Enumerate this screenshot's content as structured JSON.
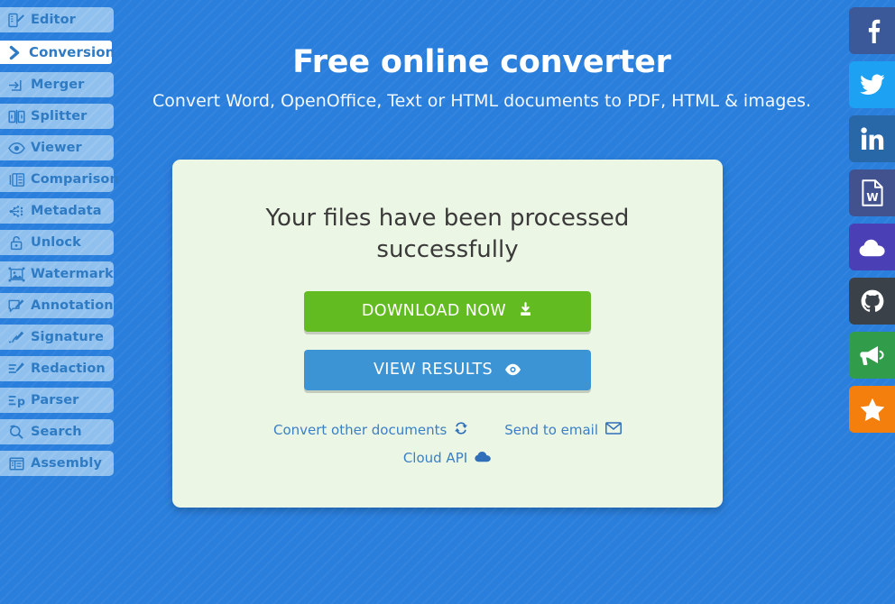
{
  "colors": {
    "page_bg": "#2a7fdd",
    "sidebar_item_bg": "#8fc0ee",
    "sidebar_item_text": "#2e7bc4",
    "card_bg": "#ecf6e4",
    "download_green": "#62bb20",
    "view_blue": "#3d94d4",
    "link_blue": "#3b7fc4"
  },
  "hero": {
    "title": "Free online converter",
    "subtitle": "Convert Word, OpenOffice, Text or HTML documents to PDF, HTML & images."
  },
  "sidebar": {
    "items": [
      {
        "label": "Editor",
        "icon": "editor-icon",
        "active": false
      },
      {
        "label": "Conversion",
        "icon": "chevron-right-icon",
        "active": true
      },
      {
        "label": "Merger",
        "icon": "merger-icon",
        "active": false
      },
      {
        "label": "Splitter",
        "icon": "splitter-icon",
        "active": false
      },
      {
        "label": "Viewer",
        "icon": "eye-icon",
        "active": false
      },
      {
        "label": "Comparison",
        "icon": "comparison-icon",
        "active": false
      },
      {
        "label": "Metadata",
        "icon": "metadata-icon",
        "active": false
      },
      {
        "label": "Unlock",
        "icon": "lock-open-icon",
        "active": false
      },
      {
        "label": "Watermark",
        "icon": "watermark-icon",
        "active": false
      },
      {
        "label": "Annotation",
        "icon": "annotation-icon",
        "active": false
      },
      {
        "label": "Signature",
        "icon": "signature-icon",
        "active": false
      },
      {
        "label": "Redaction",
        "icon": "redaction-icon",
        "active": false
      },
      {
        "label": "Parser",
        "icon": "parser-icon",
        "active": false
      },
      {
        "label": "Search",
        "icon": "search-icon",
        "active": false
      },
      {
        "label": "Assembly",
        "icon": "assembly-icon",
        "active": false
      }
    ]
  },
  "card": {
    "status_message": "Your files have been processed successfully",
    "download_button": {
      "label": "DOWNLOAD NOW",
      "icon": "download-icon"
    },
    "view_button": {
      "label": "VIEW RESULTS",
      "icon": "eye-icon"
    },
    "links": [
      {
        "label": "Convert other documents",
        "icon": "refresh-icon"
      },
      {
        "label": "Send to email",
        "icon": "envelope-icon"
      }
    ],
    "links_second_row": [
      {
        "label": "Cloud API",
        "icon": "cloud-icon"
      }
    ]
  },
  "social": {
    "items": [
      {
        "name": "facebook",
        "icon": "facebook-icon",
        "color": "#3b5998"
      },
      {
        "name": "twitter",
        "icon": "twitter-icon",
        "color": "#1da1f2"
      },
      {
        "name": "linkedin",
        "icon": "linkedin-icon",
        "color": "#2867a8"
      },
      {
        "name": "word",
        "icon": "word-doc-icon",
        "color": "#41528f"
      },
      {
        "name": "cloud",
        "icon": "cloud-icon",
        "color": "#4a3fb5"
      },
      {
        "name": "github",
        "icon": "github-icon",
        "color": "#3b4148"
      },
      {
        "name": "news",
        "icon": "megaphone-icon",
        "color": "#319d4b"
      },
      {
        "name": "star",
        "icon": "star-icon",
        "color": "#f57f0c"
      }
    ]
  }
}
